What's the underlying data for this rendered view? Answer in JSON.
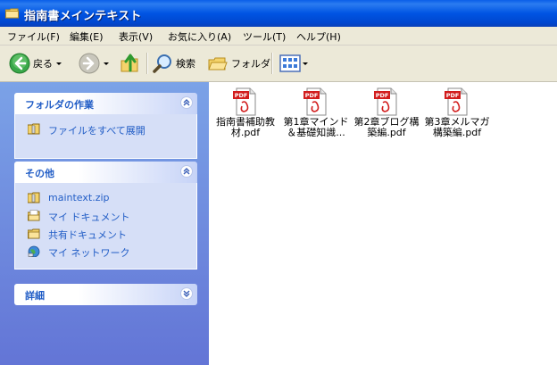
{
  "window": {
    "title": "指南書メインテキスト"
  },
  "menu": [
    {
      "label": "ファイル(F)"
    },
    {
      "label": "編集(E)"
    },
    {
      "label": "表示(V)"
    },
    {
      "label": "お気に入り(A)"
    },
    {
      "label": "ツール(T)"
    },
    {
      "label": "ヘルプ(H)"
    }
  ],
  "toolbar": {
    "back_label": "戻る",
    "search_label": "検索",
    "folders_label": "フォルダ"
  },
  "tasks": {
    "folder_tasks_title": "フォルダの作業",
    "folder_tasks": [
      {
        "label": "ファイルをすべて展開",
        "icon": "zip-extract-icon"
      }
    ],
    "other_title": "その他",
    "other_places": [
      {
        "label": "maintext.zip",
        "icon": "zip-folder-icon"
      },
      {
        "label": "マイ ドキュメント",
        "icon": "my-documents-icon"
      },
      {
        "label": "共有ドキュメント",
        "icon": "shared-documents-icon"
      },
      {
        "label": "マイ ネットワーク",
        "icon": "my-network-icon"
      }
    ],
    "details_title": "詳細"
  },
  "files": [
    {
      "name": "指南書補助教材.pdf",
      "icon": "pdf-icon"
    },
    {
      "name": "第1章マインド＆基礎知識...",
      "icon": "pdf-icon"
    },
    {
      "name": "第2章ブログ構築編.pdf",
      "icon": "pdf-icon"
    },
    {
      "name": "第3章メルマガ構築編.pdf",
      "icon": "pdf-icon"
    }
  ],
  "colors": {
    "titlebar": "#0054e3",
    "taskpane": "#7ba2e7",
    "task_link": "#215dc6"
  }
}
